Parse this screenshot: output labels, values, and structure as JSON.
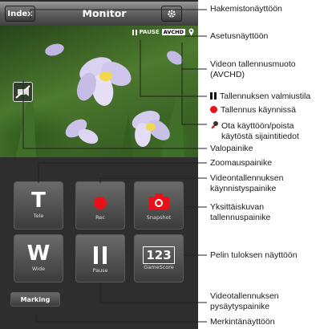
{
  "phone": {
    "index_label": "Index",
    "title": "Monitor",
    "status": {
      "pause_text": "PAUSE",
      "format_badge": "AVCHD"
    },
    "buttons": {
      "tele": {
        "big": "T",
        "small": "Tele"
      },
      "wide": {
        "big": "W",
        "small": "Wide"
      },
      "rec": {
        "small": "Rec"
      },
      "pause": {
        "small": "Pause"
      },
      "snapshot": {
        "small": "Snapshot"
      },
      "gamescore": {
        "big": "123",
        "small": "GameScore"
      },
      "marking": "Marking"
    }
  },
  "annotations": {
    "index_screen": "Hakemistonäyttöön",
    "settings_screen": "Asetusnäyttöön",
    "video_format": [
      "Videon tallennusmuoto",
      "(AVCHD)"
    ],
    "recording_standby": "Tallennuksen valmiustila",
    "recording_in_progress": "Tallennus käynnissä",
    "location_toggle": [
      "Ota käyttöön/poista",
      "käytöstä sijaintitiedot"
    ],
    "light_button": "Valopainike",
    "zoom_button": "Zoomauspainike",
    "video_start_button": [
      "Videontallennuksen",
      "käynnistyspainike"
    ],
    "snapshot_button": [
      "Yksittäiskuvan",
      "tallennuspainike"
    ],
    "game_score_screen": "Pelin tuloksen näyttöön",
    "video_pause_button": [
      "Videotallennuksen",
      "pysäytyspainike"
    ],
    "marking_screen": "Merkintänäyttöön"
  },
  "colors": {
    "record_red": "#e8111a",
    "leader_line": "#222222"
  }
}
